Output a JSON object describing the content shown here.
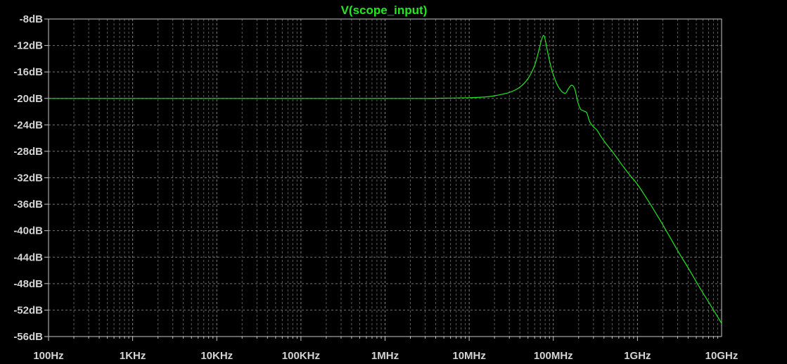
{
  "chart_data": {
    "type": "line",
    "title": "V(scope_input)",
    "xlabel": "",
    "ylabel": "",
    "x_scale": "log",
    "xlim": [
      100,
      10000000000
    ],
    "ylim": [
      -56,
      -8
    ],
    "grid": true,
    "y_tick_labels": [
      "-8dB",
      "-12dB",
      "-16dB",
      "-20dB",
      "-24dB",
      "-28dB",
      "-32dB",
      "-36dB",
      "-40dB",
      "-44dB",
      "-48dB",
      "-52dB",
      "-56dB"
    ],
    "x_tick_labels": [
      "100Hz",
      "1KHz",
      "10KHz",
      "100KHz",
      "1MHz",
      "10MHz",
      "100MHz",
      "1GHz",
      "10GHz"
    ],
    "colors": {
      "background": "#000000",
      "trace": "#22e622",
      "grid": "#9a9a9a",
      "axis": "#c8c8c8",
      "labels": "#d4d4d4"
    },
    "series": [
      {
        "name": "V(scope_input)",
        "x": [
          100,
          1000,
          10000,
          100000,
          1000000,
          3000000,
          6000000,
          10000000,
          15000000,
          20000000,
          30000000,
          40000000,
          50000000,
          60000000,
          68000000,
          73000000,
          78000000,
          85000000,
          95000000,
          110000000,
          125000000,
          140000000,
          150000000,
          165000000,
          180000000,
          195000000,
          210000000,
          230000000,
          250000000,
          270000000,
          300000000,
          330000000,
          370000000,
          420000000,
          480000000,
          550000000,
          650000000,
          800000000,
          1000000000,
          1300000000,
          1700000000,
          2200000000,
          3000000000,
          4000000000,
          5500000000,
          7500000000,
          10000000000
        ],
        "values": [
          -20,
          -20,
          -20,
          -20,
          -20,
          -20,
          -19.95,
          -19.9,
          -19.8,
          -19.6,
          -19.1,
          -18.3,
          -17.0,
          -15.0,
          -12.5,
          -11.0,
          -10.6,
          -12.8,
          -15.5,
          -17.8,
          -18.9,
          -19.2,
          -18.6,
          -18.0,
          -18.6,
          -20.5,
          -21.6,
          -21.9,
          -22.2,
          -23.5,
          -24.3,
          -24.8,
          -25.8,
          -26.8,
          -27.7,
          -28.7,
          -30.0,
          -31.5,
          -33.0,
          -35.2,
          -37.6,
          -40.0,
          -43.0,
          -45.6,
          -48.6,
          -51.4,
          -54.0
        ]
      }
    ]
  }
}
